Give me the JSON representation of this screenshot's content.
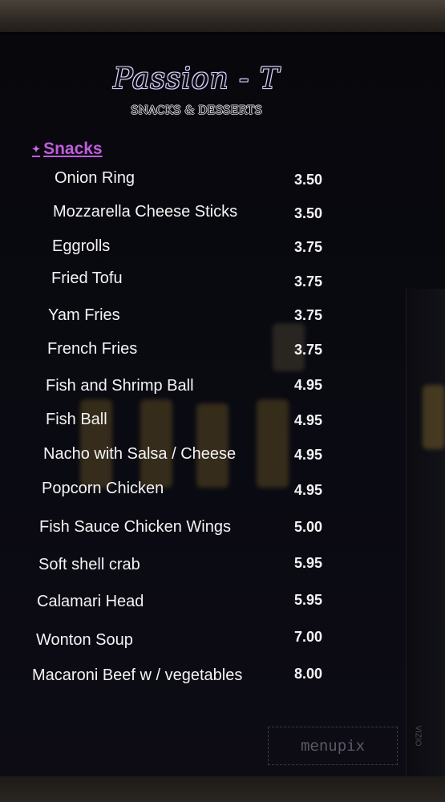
{
  "menu": {
    "title": "Passion - T",
    "subtitle": "SNACKS & DESSERTS",
    "section": "Snacks",
    "items": [
      {
        "name": "Onion Ring",
        "price": "3.50"
      },
      {
        "name": "Mozzarella Cheese Sticks",
        "price": "3.50"
      },
      {
        "name": "Eggrolls",
        "price": "3.75"
      },
      {
        "name": "Fried Tofu",
        "price": "3.75"
      },
      {
        "name": "Yam Fries",
        "price": "3.75"
      },
      {
        "name": "French Fries",
        "price": "3.75"
      },
      {
        "name": "Fish and Shrimp Ball",
        "price": "4.95"
      },
      {
        "name": "Fish Ball",
        "price": "4.95"
      },
      {
        "name": "Nacho with Salsa / Cheese",
        "price": "4.95"
      },
      {
        "name": "Popcorn Chicken",
        "price": "4.95"
      },
      {
        "name": "Fish Sauce Chicken Wings",
        "price": "5.00"
      },
      {
        "name": "Soft shell crab",
        "price": "5.95"
      },
      {
        "name": "Calamari Head",
        "price": "5.95"
      },
      {
        "name": "Wonton Soup",
        "price": "7.00"
      },
      {
        "name": "Macaroni Beef w / vegetables",
        "price": "8.00"
      }
    ]
  },
  "watermark": "menupix",
  "brand": "VIZIO",
  "colors": {
    "section_accent": "#c15ce0",
    "text": "#f4f4f6",
    "background": "#07070c"
  }
}
